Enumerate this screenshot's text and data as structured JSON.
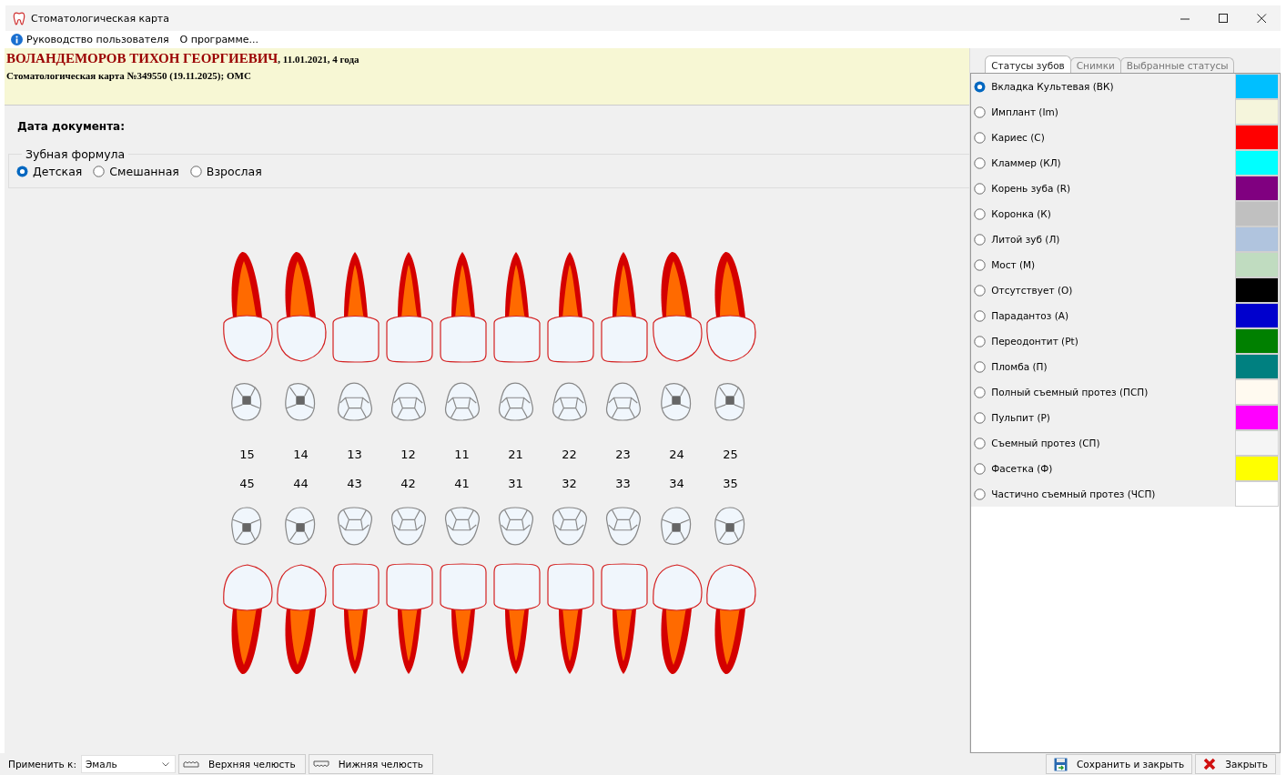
{
  "window": {
    "title": "Стоматологическая карта"
  },
  "menu": [
    {
      "label": "Руководство пользователя",
      "kind": "info"
    },
    {
      "label": "О программе..."
    }
  ],
  "patient": {
    "name": "ВОЛАНДЕМОРОВ ТИХОН ГЕОРГИЕВИЧ",
    "details": ", 11.01.2021, 4 года",
    "card": "Стоматологическая карта №349550 (19.11.2025); ОМС"
  },
  "document_date_label": "Дата документа:",
  "tooth_formula": {
    "title": "Зубная формула",
    "options": [
      {
        "label": "Детская",
        "selected": true
      },
      {
        "label": "Смешанная",
        "selected": false
      },
      {
        "label": "Взрослая",
        "selected": false
      }
    ]
  },
  "teeth": {
    "upper": [
      {
        "number": "15",
        "kind": "premolar"
      },
      {
        "number": "14",
        "kind": "premolar"
      },
      {
        "number": "13",
        "kind": "anterior"
      },
      {
        "number": "12",
        "kind": "anterior"
      },
      {
        "number": "11",
        "kind": "anterior"
      },
      {
        "number": "21",
        "kind": "anterior"
      },
      {
        "number": "22",
        "kind": "anterior"
      },
      {
        "number": "23",
        "kind": "anterior"
      },
      {
        "number": "24",
        "kind": "premolar"
      },
      {
        "number": "25",
        "kind": "premolar"
      }
    ],
    "lower": [
      {
        "number": "45",
        "kind": "premolar"
      },
      {
        "number": "44",
        "kind": "premolar"
      },
      {
        "number": "43",
        "kind": "anterior"
      },
      {
        "number": "42",
        "kind": "anterior"
      },
      {
        "number": "41",
        "kind": "anterior"
      },
      {
        "number": "31",
        "kind": "anterior"
      },
      {
        "number": "32",
        "kind": "anterior"
      },
      {
        "number": "33",
        "kind": "anterior"
      },
      {
        "number": "34",
        "kind": "premolar"
      },
      {
        "number": "35",
        "kind": "premolar"
      }
    ]
  },
  "status_tabs": [
    {
      "label": "Статусы зубов",
      "selected": true
    },
    {
      "label": "Снимки",
      "selected": false
    },
    {
      "label": "Выбранные статусы",
      "selected": false
    }
  ],
  "statuses": [
    {
      "label": "Вкладка Культевая (ВК)",
      "selected": true,
      "color": "#00bfff"
    },
    {
      "label": "Имплант (Im)",
      "selected": false,
      "color": "#f5f5dc"
    },
    {
      "label": "Кариес (С)",
      "selected": false,
      "color": "#ff0000"
    },
    {
      "label": "Кламмер (КЛ)",
      "selected": false,
      "color": "#00ffff"
    },
    {
      "label": "Корень зуба (R)",
      "selected": false,
      "color": "#800080"
    },
    {
      "label": "Коронка (К)",
      "selected": false,
      "color": "#c0c0c0"
    },
    {
      "label": "Литой зуб (Л)",
      "selected": false,
      "color": "#b0c4de"
    },
    {
      "label": "Мост (М)",
      "selected": false,
      "color": "#c0dcc0"
    },
    {
      "label": "Отсутствует (О)",
      "selected": false,
      "color": "#000000"
    },
    {
      "label": "Парадантоз (А)",
      "selected": false,
      "color": "#0000cd"
    },
    {
      "label": "Переодонтит (Pt)",
      "selected": false,
      "color": "#008000"
    },
    {
      "label": "Пломба (П)",
      "selected": false,
      "color": "#008080"
    },
    {
      "label": "Полный съемный протез (ПСП)",
      "selected": false,
      "color": "#fffaf0"
    },
    {
      "label": "Пульпит (Р)",
      "selected": false,
      "color": "#ff00ff"
    },
    {
      "label": "Съемный протез (СП)",
      "selected": false,
      "color": "#f5f5f5"
    },
    {
      "label": "Фасетка (Ф)",
      "selected": false,
      "color": "#ffff00"
    },
    {
      "label": "Частично съемный протез (ЧСП)",
      "selected": false,
      "color": "#ffffff"
    }
  ],
  "bottom": {
    "apply_label": "Применить к:",
    "apply_value": "Эмаль",
    "jaw_buttons": [
      {
        "label": "Верхняя челюсть",
        "kind": "upper"
      },
      {
        "label": "Нижняя челюсть",
        "kind": "lower"
      }
    ],
    "actions": [
      {
        "label": "Сохранить и закрыть",
        "kind": "save"
      },
      {
        "label": "Закрыть",
        "kind": "close"
      }
    ]
  }
}
